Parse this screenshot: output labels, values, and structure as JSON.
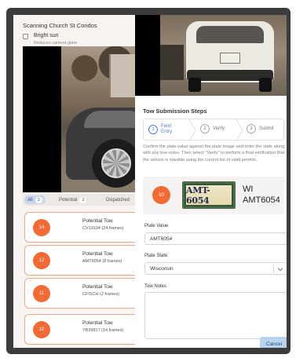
{
  "left_panel": {
    "title": "Scanning Church St Condos",
    "bright_sun": {
      "label": "Bright sun",
      "sublabel": "Reduces camera glare",
      "checked": false
    },
    "tabs": [
      {
        "label": "All",
        "count": "3",
        "active": true
      },
      {
        "label": "Potential",
        "count": "3",
        "active": false
      },
      {
        "label": "Dispatched",
        "count": "",
        "active": false
      }
    ],
    "cards": [
      {
        "badge": "14",
        "title": "Potential Tow",
        "subtitle": "CV19194 (24 frames)"
      },
      {
        "badge": "12",
        "title": "Potential Tow",
        "subtitle": "AMT6054 (8 frames)"
      },
      {
        "badge": "11",
        "title": "Potential Tow",
        "subtitle": "CFISCH (2 frames)"
      },
      {
        "badge": "10",
        "title": "Potential Tow",
        "subtitle": "YB39817 (14 frames)"
      }
    ]
  },
  "right_panel": {
    "title": "Tow Submission Steps",
    "steps": [
      {
        "num": "1",
        "label_line1": "Field",
        "label_line2": "Entry",
        "active": true
      },
      {
        "num": "2",
        "label_line1": "Verify",
        "label_line2": "",
        "active": false
      },
      {
        "num": "3",
        "label_line1": "Submit",
        "label_line2": "",
        "active": false
      }
    ],
    "description": "Confirm the plate value against the plate image and enter the state along with any tow notes. Then select \"Verify\" to perform a final verification that the vehicle is towable using the current list of valid permits.",
    "plate": {
      "badge": "10",
      "plate_image_text": "AMT-6054",
      "state": "WI",
      "number": "AMT6054"
    },
    "form": {
      "plate_value_label": "Plate Value",
      "plate_value": "AMT6054",
      "plate_state_label": "Plate State",
      "plate_state": "Wisconsin",
      "tow_notes_label": "Tow Notes",
      "tow_notes": ""
    },
    "cancel_label": "Cancel"
  },
  "colors": {
    "accent_orange": "#f26b34",
    "active_blue": "#4f7fd6",
    "cancel_bg": "#b9d2ee",
    "bezel": "#3c3c3c"
  }
}
